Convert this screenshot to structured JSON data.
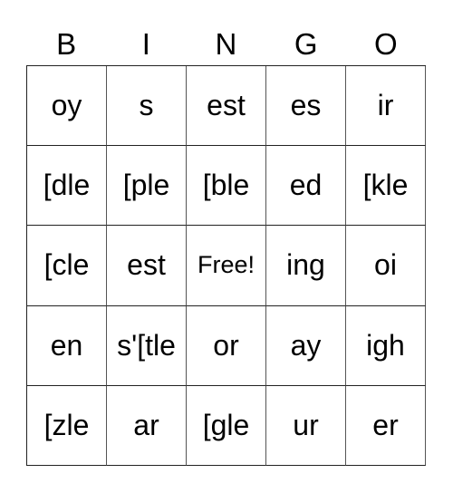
{
  "card": {
    "header": [
      "B",
      "I",
      "N",
      "G",
      "O"
    ],
    "rows": [
      [
        "oy",
        "s",
        "est",
        "es",
        "ir"
      ],
      [
        "[dle",
        "[ple",
        "[ble",
        "ed",
        "[kle"
      ],
      [
        "[cle",
        "est",
        "Free!",
        "ing",
        "oi"
      ],
      [
        "en",
        "s'[tle",
        "or",
        "ay",
        "igh"
      ],
      [
        "[zle",
        "ar",
        "[gle",
        "ur",
        "er"
      ]
    ],
    "free_cell": {
      "row": 2,
      "col": 2
    }
  }
}
